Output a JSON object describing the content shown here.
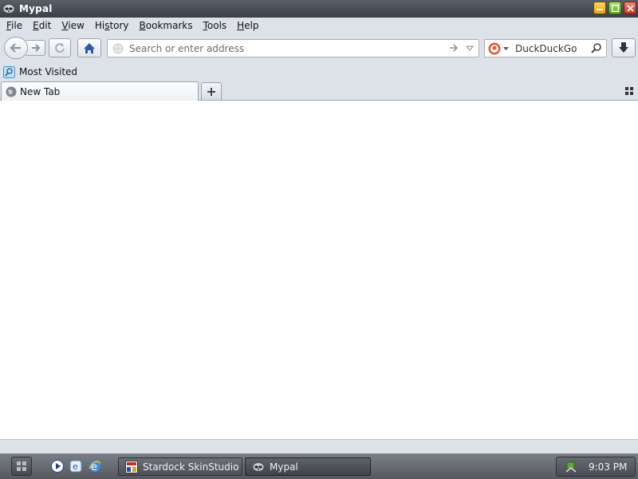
{
  "window": {
    "title": "Mypal",
    "app_icon": "raccoon-icon",
    "controls": [
      "minimize",
      "maximize",
      "close"
    ]
  },
  "menu": {
    "items": [
      {
        "label": "File",
        "accel": "F"
      },
      {
        "label": "Edit",
        "accel": "E"
      },
      {
        "label": "View",
        "accel": "V"
      },
      {
        "label": "History",
        "accel": "s"
      },
      {
        "label": "Bookmarks",
        "accel": "B"
      },
      {
        "label": "Tools",
        "accel": "T"
      },
      {
        "label": "Help",
        "accel": "H"
      }
    ]
  },
  "navbar": {
    "buttons": [
      "back",
      "forward",
      "reload",
      "home",
      "downloads"
    ],
    "url": {
      "value": "",
      "placeholder": "Search or enter address"
    },
    "search": {
      "engine": "DuckDuckGo",
      "value": "",
      "placeholder": "DuckDuckGo"
    }
  },
  "bookmarks": {
    "items": [
      {
        "label": "Most Visited",
        "icon": "most-visited-icon"
      }
    ]
  },
  "tabs": {
    "items": [
      {
        "label": "New Tab",
        "icon": "globe-icon",
        "active": true
      }
    ]
  },
  "taskbar": {
    "quick_launch": [
      "media-player-icon",
      "browser-icon",
      "internet-explorer-icon"
    ],
    "tasks": [
      {
        "label": "Stardock SkinStudio",
        "icon": "skinstudio-icon"
      },
      {
        "label": "Mypal",
        "icon": "raccoon-icon",
        "active": true
      }
    ],
    "tray": {
      "clock": "9:03 PM",
      "icon": "network-icon"
    }
  },
  "colors": {
    "chrome": "#dde2e8",
    "titlebar": "#4a4f56",
    "taskbar": "#65696f",
    "home_icon": "#2b5aa8"
  }
}
